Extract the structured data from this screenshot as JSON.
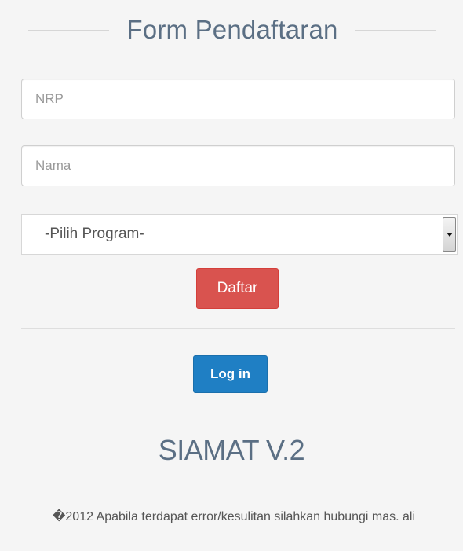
{
  "form": {
    "title": "Form Pendaftaran",
    "nrp_placeholder": "NRP",
    "nama_placeholder": "Nama",
    "program_select": {
      "selected": "-Pilih Program-"
    },
    "daftar_label": "Daftar"
  },
  "login": {
    "label": "Log in"
  },
  "brand": {
    "name": "SIAMAT V.2"
  },
  "footer": {
    "text": "�2012 Apabila terdapat error/kesulitan silahkan hubungi mas. ali"
  },
  "colors": {
    "page_background": "#f5f5f5",
    "title_text": "#5b6f84",
    "daftar_button": "#d9534f",
    "login_button": "#1f7fc4"
  },
  "icons": {
    "select_arrow": "caret-down-icon"
  }
}
